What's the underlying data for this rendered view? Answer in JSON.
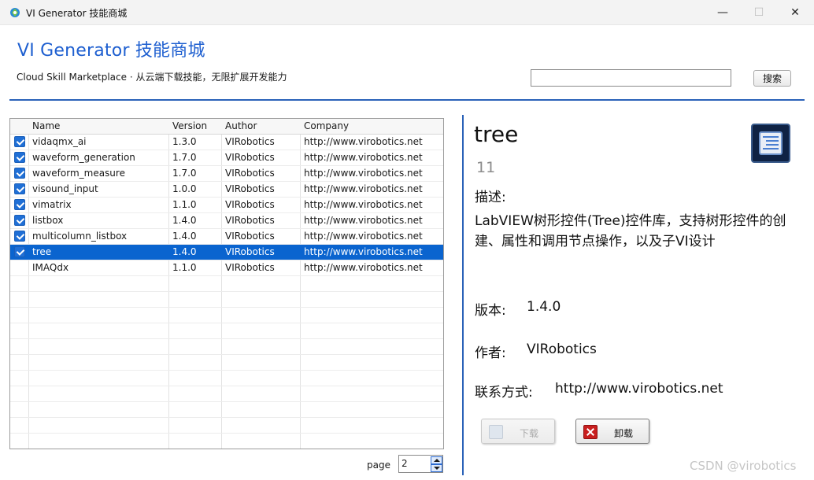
{
  "window": {
    "title": "VI Generator  技能商城",
    "minimize_glyph": "—",
    "maximize_glyph": "☐",
    "close_glyph": "✕"
  },
  "header": {
    "title": "VI Generator  技能商城",
    "subtitle": "Cloud Skill Marketplace  ·  从云端下载技能，无限扩展开发能力",
    "search_value": "",
    "search_button": "搜索"
  },
  "table": {
    "columns": [
      "Name",
      "Version",
      "Author",
      "Company"
    ],
    "rows": [
      {
        "checked": true,
        "name": "vidaqmx_ai",
        "version": "1.3.0",
        "author": "VIRobotics",
        "company": "http://www.virobotics.net"
      },
      {
        "checked": true,
        "name": "waveform_generation",
        "version": "1.7.0",
        "author": "VIRobotics",
        "company": "http://www.virobotics.net"
      },
      {
        "checked": true,
        "name": "waveform_measure",
        "version": "1.7.0",
        "author": "VIRobotics",
        "company": "http://www.virobotics.net"
      },
      {
        "checked": true,
        "name": "visound_input",
        "version": "1.0.0",
        "author": "VIRobotics",
        "company": "http://www.virobotics.net"
      },
      {
        "checked": true,
        "name": "vimatrix",
        "version": "1.1.0",
        "author": "VIRobotics",
        "company": "http://www.virobotics.net"
      },
      {
        "checked": true,
        "name": "listbox",
        "version": "1.4.0",
        "author": "VIRobotics",
        "company": "http://www.virobotics.net"
      },
      {
        "checked": true,
        "name": "multicolumn_listbox",
        "version": "1.4.0",
        "author": "VIRobotics",
        "company": "http://www.virobotics.net"
      },
      {
        "checked": true,
        "name": "tree",
        "version": "1.4.0",
        "author": "VIRobotics",
        "company": "http://www.virobotics.net",
        "selected": true
      },
      {
        "checked": false,
        "name": "IMAQdx",
        "version": "1.1.0",
        "author": "VIRobotics",
        "company": "http://www.virobotics.net"
      }
    ],
    "selected_color": "#0a64cf"
  },
  "pager": {
    "label": "page",
    "value": "2"
  },
  "detail": {
    "name": "tree",
    "count": "11",
    "desc_label": "描述:",
    "description": "LabVIEW树形控件(Tree)控件库，支持树形控件的创建、属性和调用节点操作，以及子VI设计",
    "version_label": "版本:",
    "version": "1.4.0",
    "author_label": "作者:",
    "author": "VIRobotics",
    "contact_label": "联系方式:",
    "contact": "http://www.virobotics.net",
    "download_button": "下载",
    "uninstall_button": "卸载",
    "icon": "tree-control-icon"
  },
  "watermark": "CSDN @virobotics",
  "colors": {
    "accent": "#1e5fd0",
    "divider": "#2a62b8"
  }
}
